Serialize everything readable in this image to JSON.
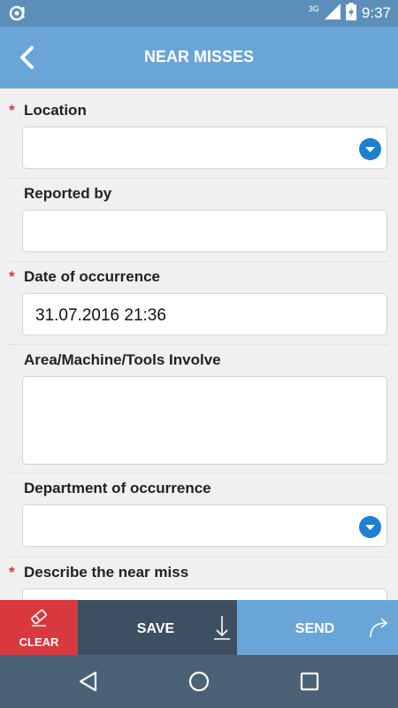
{
  "status_bar": {
    "network": "3G",
    "time": "9:37",
    "icons": [
      "app-notification-icon",
      "signal-icon",
      "battery-charging-icon"
    ]
  },
  "app_bar": {
    "title": "NEAR MISSES",
    "back_icon": "chevron-left-icon"
  },
  "form": {
    "location": {
      "label": "Location",
      "required": true,
      "value": ""
    },
    "reported_by": {
      "label": "Reported by",
      "required": false,
      "value": ""
    },
    "date_of_occurrence": {
      "label": "Date of occurrence",
      "required": true,
      "value": "31.07.2016 21:36"
    },
    "area": {
      "label": "Area/Machine/Tools Involve",
      "required": false,
      "value": ""
    },
    "department": {
      "label": "Department of occurrence",
      "required": true,
      "value": ""
    },
    "describe": {
      "label": "Describe the near miss",
      "required": true,
      "value": ""
    }
  },
  "actions": {
    "clear_label": "CLEAR",
    "save_label": "SAVE",
    "send_label": "SEND"
  },
  "colors": {
    "status_bar": "#5b8fb9",
    "app_bar": "#6aa5d8",
    "required": "#e0303b",
    "dropdown": "#1f7fd0",
    "clear": "#d9393e",
    "save": "#3e4f61",
    "send": "#6aa5d8",
    "navbar": "#4a6176"
  },
  "nav_icons": [
    "back-triangle-icon",
    "home-circle-icon",
    "recents-square-icon"
  ]
}
